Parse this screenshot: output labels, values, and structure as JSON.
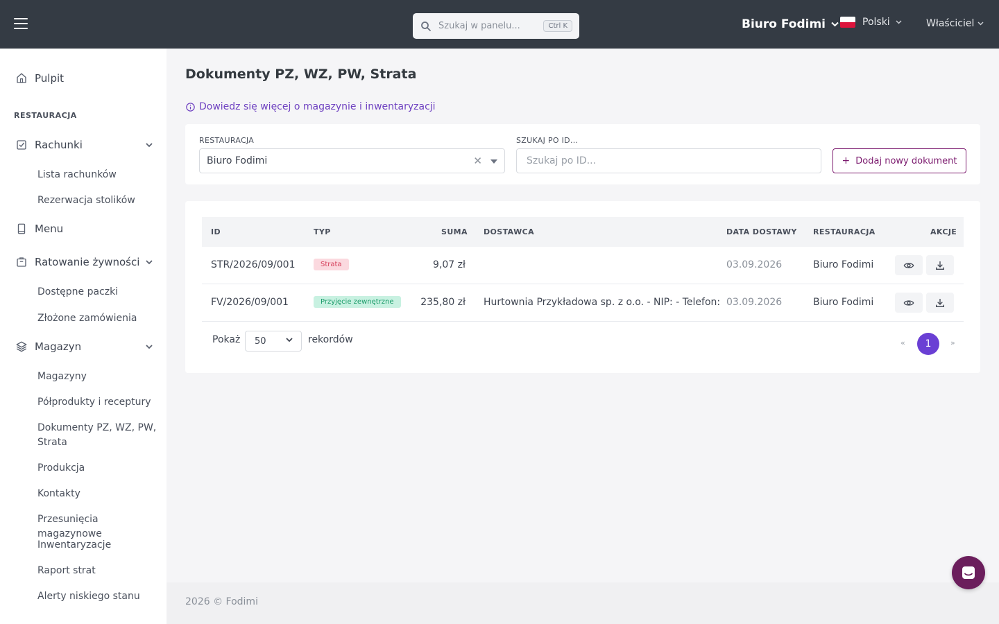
{
  "topbar": {
    "search_placeholder": "Szukaj w panelu...",
    "search_shortcut": "Ctrl K",
    "restaurant": "Biuro Fodimi",
    "language": "Polski",
    "role": "Właściciel"
  },
  "sidebar": {
    "dashboard": "Pulpit",
    "section": "RESTAURACJA",
    "groups": [
      {
        "label": "Rachunki",
        "items": [
          "Lista rachunków",
          "Rezerwacja stolików"
        ]
      },
      {
        "label": "Menu"
      },
      {
        "label": "Ratowanie żywności",
        "items": [
          "Dostępne paczki",
          "Złożone zamówienia"
        ]
      },
      {
        "label": "Magazyn",
        "items": [
          "Magazyny",
          "Półprodukty i receptury",
          "Dokumenty PZ, WZ, PW, Strata",
          "Produkcja",
          "Kontakty",
          "Przesunięcia magazynowe",
          "Inwentaryzacje",
          "Raport strat",
          "Alerty niskiego stanu"
        ]
      }
    ]
  },
  "main": {
    "title": "Dokumenty PZ, WZ, PW, Strata",
    "info_link": "Dowiedz się więcej o magazynie i inwentaryzacji",
    "filters": {
      "restaurant_label": "RESTAURACJA",
      "restaurant_value": "Biuro Fodimi",
      "search_label": "SZUKAJ PO ID...",
      "search_placeholder": "Szukaj po ID...",
      "add_button": "Dodaj nowy dokument"
    },
    "table": {
      "columns": [
        "ID",
        "TYP",
        "SUMA",
        "DOSTAWCA",
        "DATA DOSTAWY",
        "RESTAURACJA",
        "AKCJE"
      ],
      "rows": [
        {
          "id": "STR/2026/09/001",
          "type": "Strata",
          "type_style": "strata",
          "sum": "9,07 zł",
          "supplier": "",
          "date": "03.09.2026",
          "restaurant": "Biuro Fodimi"
        },
        {
          "id": "FV/2026/09/001",
          "type": "Przyjęcie zewnętrzne",
          "type_style": "ext",
          "sum": "235,80 zł",
          "supplier": "Hurtownia Przykładowa sp. z o.o. - NIP: - Telefon:",
          "date": "03.09.2026",
          "restaurant": "Biuro Fodimi"
        }
      ]
    },
    "pagination": {
      "show_label": "Pokaż",
      "page_size": "50",
      "records_label": "rekordów",
      "prev": "«",
      "current": "1",
      "next": "»"
    }
  },
  "footer": "2026 © Fodimi",
  "colors": {
    "topbar": "#343b44",
    "accent": "#6a3fd4",
    "add_button": "#7b1a6e",
    "chat": "#6b1e5c"
  },
  "icons": [
    "menu-icon",
    "search-icon",
    "chevron-down-icon",
    "home-icon",
    "checklist-icon",
    "book-icon",
    "box-icon",
    "layers-icon",
    "info-icon",
    "clear-icon",
    "plus-icon",
    "eye-icon",
    "download-icon",
    "chat-icon"
  ]
}
